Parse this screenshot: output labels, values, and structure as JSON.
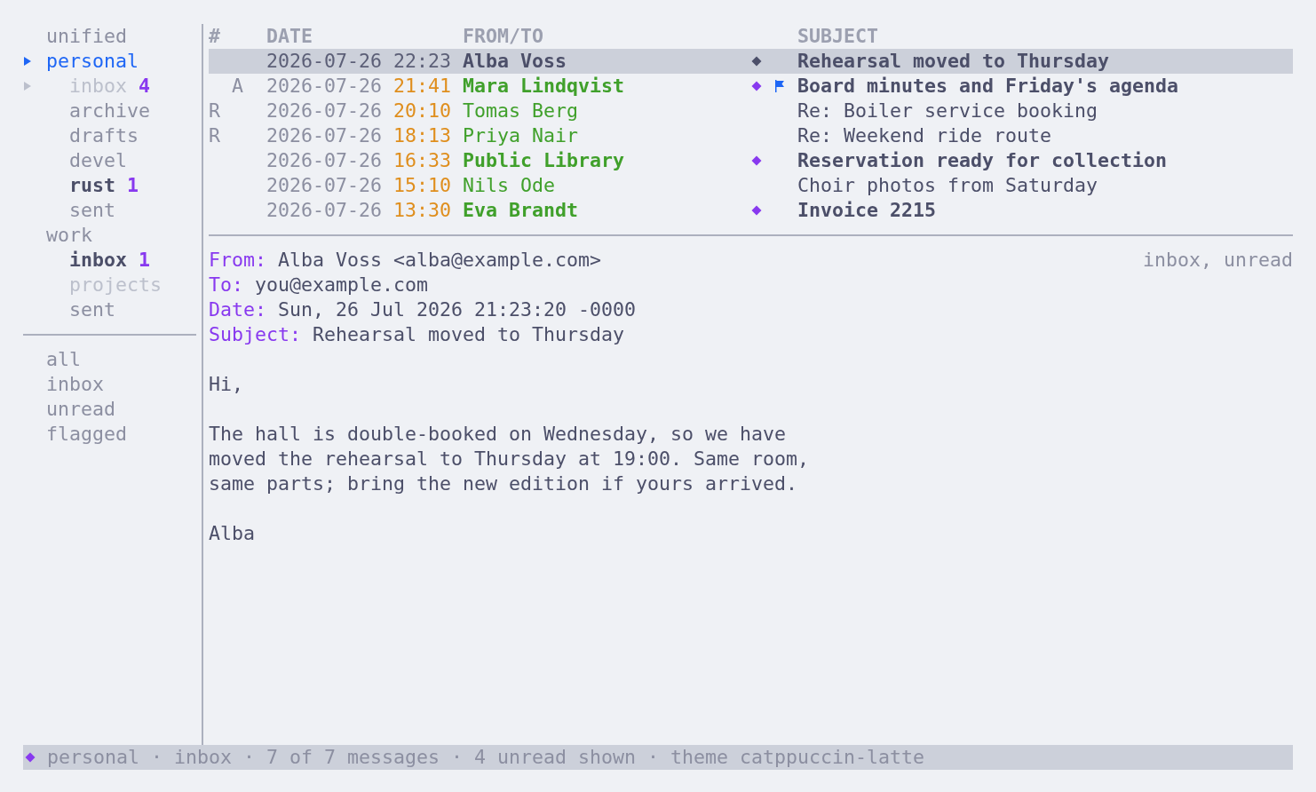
{
  "sidebar": {
    "accounts": [
      {
        "label": "unified",
        "selected": false
      },
      {
        "label": "personal",
        "selected": true,
        "children": [
          {
            "label": "inbox",
            "count": "4",
            "selected": false,
            "cursor": true,
            "unread": false,
            "muted": true
          },
          {
            "label": "archive",
            "selected": false,
            "cursor": false,
            "unread": false,
            "muted": false
          },
          {
            "label": "drafts",
            "selected": false,
            "cursor": false,
            "unread": false,
            "muted": false
          },
          {
            "label": "devel",
            "selected": false,
            "cursor": false,
            "unread": false,
            "muted": false
          },
          {
            "label": "rust",
            "count": "1",
            "selected": false,
            "cursor": false,
            "unread": true,
            "muted": false
          },
          {
            "label": "sent",
            "selected": false,
            "cursor": false,
            "unread": false,
            "muted": false
          }
        ]
      },
      {
        "label": "work",
        "selected": false,
        "children": [
          {
            "label": "inbox",
            "count": "1",
            "selected": false,
            "cursor": false,
            "unread": true,
            "muted": false
          },
          {
            "label": "projects",
            "selected": false,
            "cursor": false,
            "unread": false,
            "muted": true
          },
          {
            "label": "sent",
            "selected": false,
            "cursor": false,
            "unread": false,
            "muted": false
          }
        ]
      }
    ],
    "filters": [
      "all",
      "inbox",
      "unread",
      "flagged"
    ]
  },
  "messages": {
    "columns": [
      "#",
      "DATE",
      "FROM/TO",
      "SUBJECT"
    ],
    "list": [
      {
        "date": "2026-07-26",
        "time": "22:23",
        "from": "Alba Voss",
        "subject": "Rehearsal moved to Thursday",
        "selected": true,
        "unread": true,
        "flagged": false
      },
      {
        "attachment_mark": "A",
        "date": "2026-07-26",
        "time": "21:41",
        "from": "Mara Lindqvist",
        "subject": "Board minutes and Friday's agenda",
        "selected": false,
        "unread": true,
        "flagged": true
      },
      {
        "replied_mark": "R",
        "date": "2026-07-26",
        "time": "20:10",
        "from": "Tomas Berg",
        "subject": "Re: Boiler service booking",
        "selected": false,
        "unread": false,
        "flagged": false
      },
      {
        "replied_mark": "R",
        "date": "2026-07-26",
        "time": "18:13",
        "from": "Priya Nair",
        "subject": "Re: Weekend ride route",
        "selected": false,
        "unread": false,
        "flagged": false
      },
      {
        "date": "2026-07-26",
        "time": "16:33",
        "from": "Public Library",
        "subject": "Reservation ready for collection",
        "selected": false,
        "unread": true,
        "flagged": false
      },
      {
        "date": "2026-07-26",
        "time": "15:10",
        "from": "Nils Ode",
        "subject": "Choir photos from Saturday",
        "selected": false,
        "unread": false,
        "flagged": false
      },
      {
        "date": "2026-07-26",
        "time": "13:30",
        "from": "Eva Brandt",
        "subject": "Invoice 2215",
        "selected": false,
        "unread": true,
        "flagged": false
      }
    ]
  },
  "preview": {
    "headers": [
      {
        "label": "From:",
        "value": "Alba Voss <alba@example.com>"
      },
      {
        "label": "To:",
        "value": "you@example.com"
      },
      {
        "label": "Date:",
        "value": "Sun, 26 Jul 2026 21:23:20 -0000"
      },
      {
        "label": "Subject:",
        "value": "Rehearsal moved to Thursday"
      }
    ],
    "tags": "inbox, unread",
    "body": [
      {
        "lines": [
          "Hi,"
        ]
      },
      {
        "lines": [
          "The hall is double-booked on Wednesday, so we have",
          "moved the rehearsal to Thursday at 19:00. Same room,",
          "same parts; bring the new edition if yours arrived."
        ]
      },
      {
        "lines": [
          "Alba"
        ]
      }
    ]
  },
  "status_bar": {
    "text": "personal · inbox · 7 of 7 messages · 4 unread shown · theme catppuccin-latte"
  }
}
